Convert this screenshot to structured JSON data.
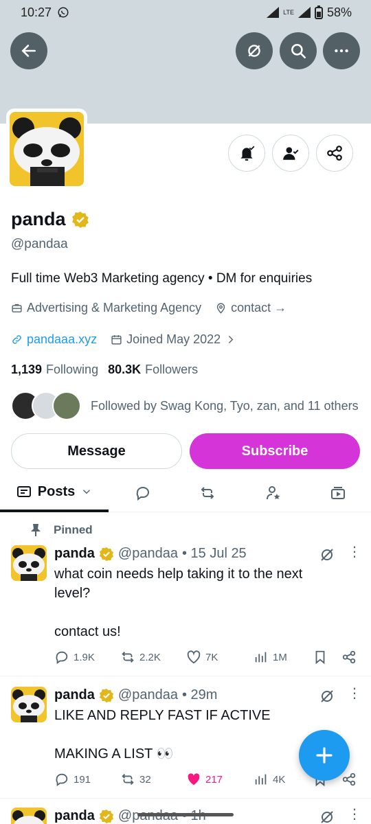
{
  "status": {
    "time": "10:27",
    "network": "LTE",
    "battery": "58%"
  },
  "profile": {
    "name": "panda",
    "handle": "@pandaa",
    "bio": "Full time Web3 Marketing agency • DM for enquiries",
    "category": "Advertising & Marketing Agency",
    "contact": "contact →",
    "website": "pandaaa.xyz",
    "joined": "Joined May 2022",
    "following_count": "1,139",
    "following_label": "Following",
    "followers_count": "80.3K",
    "followers_label": "Followers",
    "followed_by": "Followed by Swag Kong, Tyo, zan, and 11 others"
  },
  "buttons": {
    "message": "Message",
    "subscribe": "Subscribe"
  },
  "tabs": {
    "posts": "Posts"
  },
  "pinned_label": "Pinned",
  "colors": {
    "accent": "#1d9bf0",
    "subscribe": "#d534d8",
    "badge": "#e2b719",
    "like": "#f91880",
    "banner": "#cfd9de"
  },
  "tweets": [
    {
      "name": "panda",
      "handle": "@pandaa",
      "time": "• 15 Jul 25",
      "text": "what coin needs help taking it to the next\nlevel?\n\ncontact us!",
      "replies": "1.9K",
      "reposts": "2.2K",
      "likes": "7K",
      "views": "1M"
    },
    {
      "name": "panda",
      "handle": "@pandaa",
      "time": "• 29m",
      "text": "LIKE AND REPLY FAST IF ACTIVE\n\nMAKING A LIST 👀",
      "replies": "191",
      "reposts": "32",
      "likes": "217",
      "views": "4K"
    },
    {
      "name": "panda",
      "handle": "@pandaa",
      "time": "• 1h"
    }
  ]
}
